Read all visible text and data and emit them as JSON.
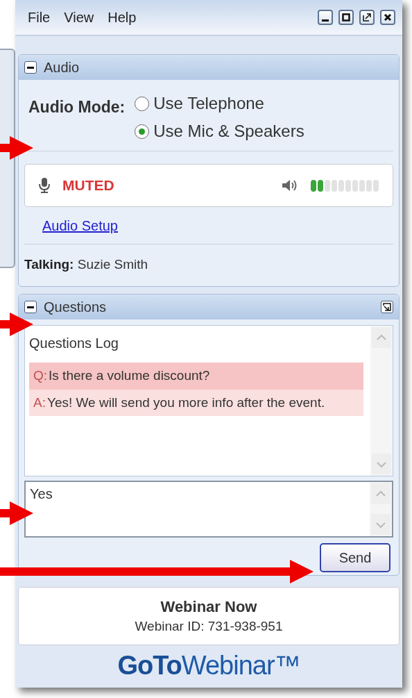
{
  "menu": [
    "File",
    "View",
    "Help"
  ],
  "audio": {
    "title": "Audio",
    "mode_label": "Audio Mode:",
    "options": [
      {
        "label": "Use Telephone",
        "selected": false
      },
      {
        "label": "Use Mic & Speakers",
        "selected": true
      }
    ],
    "mic_status": "MUTED",
    "level": 0.2,
    "setup_link": "Audio Setup",
    "talking_label": "Talking:",
    "talking_name": "Suzie Smith"
  },
  "questions": {
    "title": "Questions",
    "log_title": "Questions Log",
    "entries": [
      {
        "kind": "question",
        "prefix": "Q:",
        "text": "Is there a volume discount?"
      },
      {
        "kind": "answer",
        "prefix": "A:",
        "text": "Yes! We will send you more info after the event."
      }
    ],
    "input_value": "Yes",
    "send_button": "Send"
  },
  "webinar": {
    "name": "Webinar Now",
    "id": "Webinar ID: 731-938-951"
  },
  "logo": "**GoTo**Webinar™"
}
